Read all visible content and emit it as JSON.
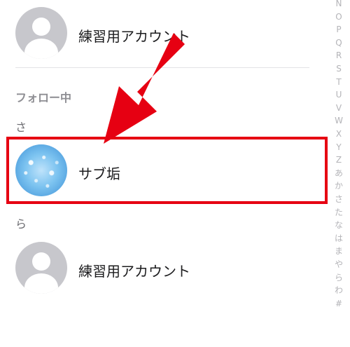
{
  "rows": {
    "top_account": {
      "name": "練習用アカウント"
    },
    "following_section": "フォロー中",
    "group_sa": "さ",
    "sub_account": {
      "name": "サブ垢"
    },
    "group_ra": "ら",
    "bottom_account": {
      "name": "練習用アカウント"
    }
  },
  "index": [
    "N",
    "O",
    "P",
    "Q",
    "R",
    "S",
    "T",
    "U",
    "V",
    "W",
    "X",
    "Y",
    "Z",
    "あ",
    "か",
    "さ",
    "た",
    "な",
    "は",
    "ま",
    "や",
    "ら",
    "わ",
    "#"
  ],
  "colors": {
    "highlight": "#e60012",
    "arrow": "#e60012",
    "avatar_default": "#c7c7cc"
  }
}
